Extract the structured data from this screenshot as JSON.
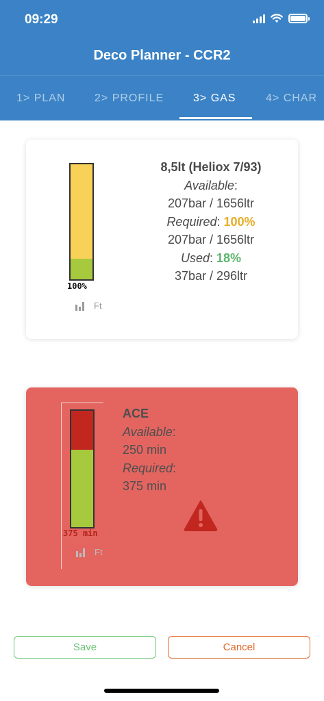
{
  "status_bar": {
    "time": "09:29"
  },
  "app": {
    "title": "Deco Planner - CCR2"
  },
  "tabs": [
    {
      "label": "1> PLAN",
      "active": false
    },
    {
      "label": "2> PROFILE",
      "active": false
    },
    {
      "label": "3> GAS",
      "active": true
    },
    {
      "label": "4> CHAR",
      "active": false
    }
  ],
  "gas_card": {
    "name": "8,5lt (Heliox 7/93)",
    "available_label": "Available",
    "available_value": "207bar / 1656ltr",
    "required_label": "Required",
    "required_pct": "100%",
    "required_value": "207bar / 1656ltr",
    "used_label": "Used",
    "used_pct": "18%",
    "used_value": "37bar / 296ltr",
    "gauge_label": "100%",
    "gauge_used_fraction": 0.18,
    "mini_label": "Ft"
  },
  "ace_card": {
    "name": "ACE",
    "available_label": "Available",
    "available_value": "250 min",
    "required_label": "Required",
    "required_value": "375 min",
    "gauge_label": "375 min",
    "gauge_available_fraction": 0.667,
    "mini_label": "Ft"
  },
  "buttons": {
    "save": "Save",
    "cancel": "Cancel"
  },
  "colors": {
    "header": "#3b83c6",
    "gauge_green": "#a6c93d",
    "gauge_yellow": "#f7d158",
    "gauge_red": "#c1271f",
    "alert_card": "#e46560"
  }
}
